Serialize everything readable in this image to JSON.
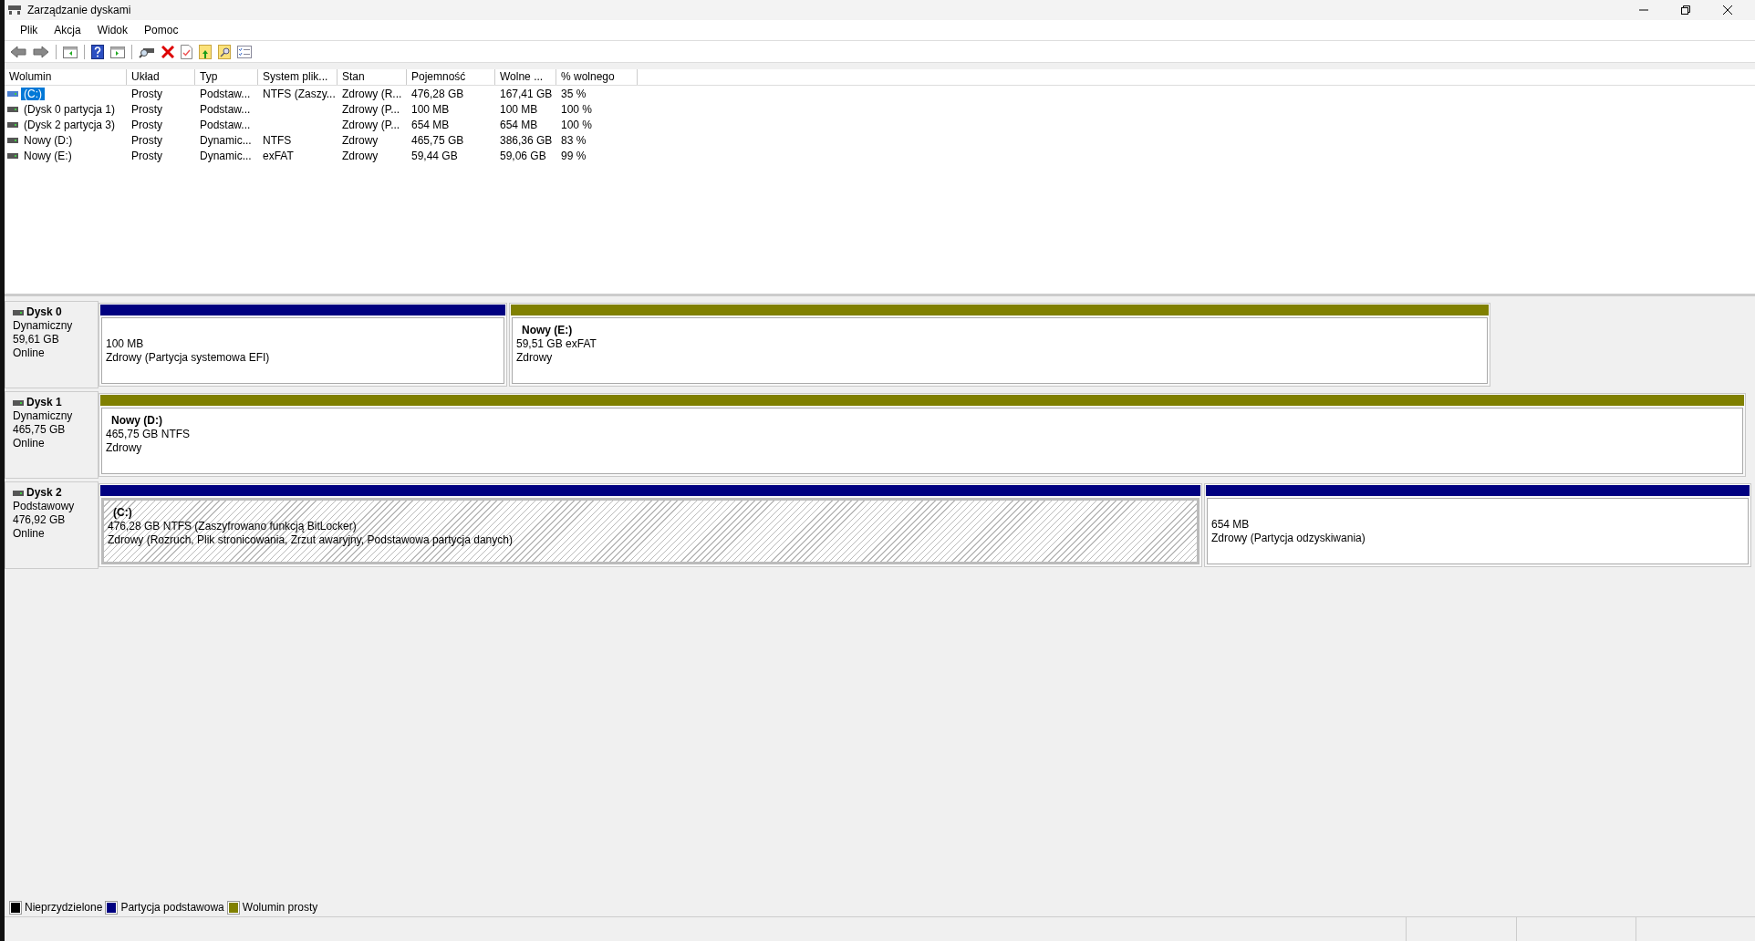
{
  "window": {
    "title": "Zarządzanie dyskami"
  },
  "menu": [
    "Plik",
    "Akcja",
    "Widok",
    "Pomoc"
  ],
  "table": {
    "columns": [
      "Wolumin",
      "Układ",
      "Typ",
      "System plik...",
      "Stan",
      "Pojemność",
      "Wolne ...",
      "% wolnego"
    ],
    "rows": [
      {
        "selected": true,
        "cells": [
          "(C:)",
          "Prosty",
          "Podstaw...",
          "NTFS (Zaszy...",
          "Zdrowy (R...",
          "476,28 GB",
          "167,41 GB",
          "35 %"
        ]
      },
      {
        "selected": false,
        "cells": [
          "(Dysk 0 partycja 1)",
          "Prosty",
          "Podstaw...",
          "",
          "Zdrowy (P...",
          "100 MB",
          "100 MB",
          "100 %"
        ]
      },
      {
        "selected": false,
        "cells": [
          "(Dysk 2 partycja 3)",
          "Prosty",
          "Podstaw...",
          "",
          "Zdrowy (P...",
          "654 MB",
          "654 MB",
          "100 %"
        ]
      },
      {
        "selected": false,
        "cells": [
          "Nowy (D:)",
          "Prosty",
          "Dynamic...",
          "NTFS",
          "Zdrowy",
          "465,75 GB",
          "386,36 GB",
          "83 %"
        ]
      },
      {
        "selected": false,
        "cells": [
          "Nowy (E:)",
          "Prosty",
          "Dynamic...",
          "exFAT",
          "Zdrowy",
          "59,44 GB",
          "59,06 GB",
          "99 %"
        ]
      }
    ]
  },
  "disks": [
    {
      "name": "Dysk 0",
      "type": "Dynamiczny",
      "size": "59,61 GB",
      "status": "Online",
      "partitions": [
        {
          "kind": "primary",
          "selected": false,
          "size": "100 MB",
          "status": "Zdrowy (Partycja systemowa EFI)"
        },
        {
          "kind": "simple",
          "selected": false,
          "name": "Nowy  (E:)",
          "size": "59,51 GB exFAT",
          "status": "Zdrowy"
        }
      ]
    },
    {
      "name": "Dysk 1",
      "type": "Dynamiczny",
      "size": "465,75 GB",
      "status": "Online",
      "partitions": [
        {
          "kind": "simple",
          "selected": false,
          "name": "Nowy  (D:)",
          "size": "465,75 GB NTFS",
          "status": "Zdrowy"
        }
      ]
    },
    {
      "name": "Dysk 2",
      "type": "Podstawowy",
      "size": "476,92 GB",
      "status": "Online",
      "partitions": [
        {
          "kind": "primary",
          "selected": true,
          "name": "(C:)",
          "size": "476,28 GB NTFS (Zaszyfrowano funkcją BitLocker)",
          "status": "Zdrowy (Rozruch, Plik stronicowania, Zrzut awaryjny, Podstawowa partycja danych)"
        },
        {
          "kind": "primary",
          "selected": false,
          "size": "654 MB",
          "status": "Zdrowy (Partycja odzyskiwania)"
        }
      ]
    }
  ],
  "legend": [
    {
      "label": "Nieprzydzielone",
      "color": "#000000"
    },
    {
      "label": "Partycja podstawowa",
      "color": "#000080"
    },
    {
      "label": "Wolumin prosty",
      "color": "#808000"
    }
  ]
}
